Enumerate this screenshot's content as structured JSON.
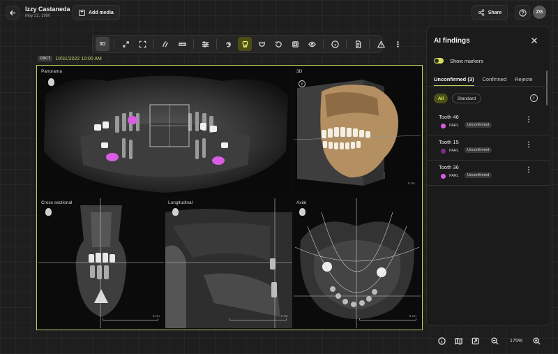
{
  "header": {
    "patient_name": "Izzy Castaneda",
    "patient_dob": "May 22, 1980",
    "add_media_label": "Add media",
    "share_label": "Share",
    "avatar_initials": "ZG"
  },
  "toolbar": {
    "items": [
      "3d-view",
      "expand-arrows",
      "fullscreen-frame",
      "curve-tool",
      "ruler-tool",
      "adjust-sliders",
      "ear-tool",
      "tooth-tool",
      "implant-tool",
      "rotate-tool",
      "crop-tool",
      "eye-tool",
      "info",
      "report",
      "warning",
      "more"
    ],
    "three_d_label": "3D"
  },
  "study": {
    "modality": "CBCT",
    "date": "10/31/2022 10:00 AM"
  },
  "panes": {
    "panorama": "Panorama",
    "three_d": "3D",
    "cross_sectional": "Cross sectional",
    "longitudinal": "Longitudinal",
    "axial": "Axial",
    "scale_label": "5 cm"
  },
  "ai_panel": {
    "title": "AI findings",
    "show_markers_label": "Show markers",
    "show_markers_on": true,
    "tabs": [
      "Unconfirmed (3)",
      "Confirmed",
      "Rejecte"
    ],
    "filters": [
      "All",
      "Standard"
    ],
    "findings": [
      {
        "tooth": "Tooth 46",
        "type": "PARL",
        "status": "Unconfirmed",
        "color": "#d95ce6"
      },
      {
        "tooth": "Tooth 15",
        "type": "PARL",
        "status": "Unconfirmed",
        "color": "#7a2f84"
      },
      {
        "tooth": "Tooth 36",
        "type": "PARL",
        "status": "Unconfirmed",
        "color": "#d95ce6"
      }
    ]
  },
  "bottom_bar": {
    "zoom_level": "175%"
  },
  "colors": {
    "accent": "#c5d05a",
    "marker_pink": "#d95ce6"
  }
}
